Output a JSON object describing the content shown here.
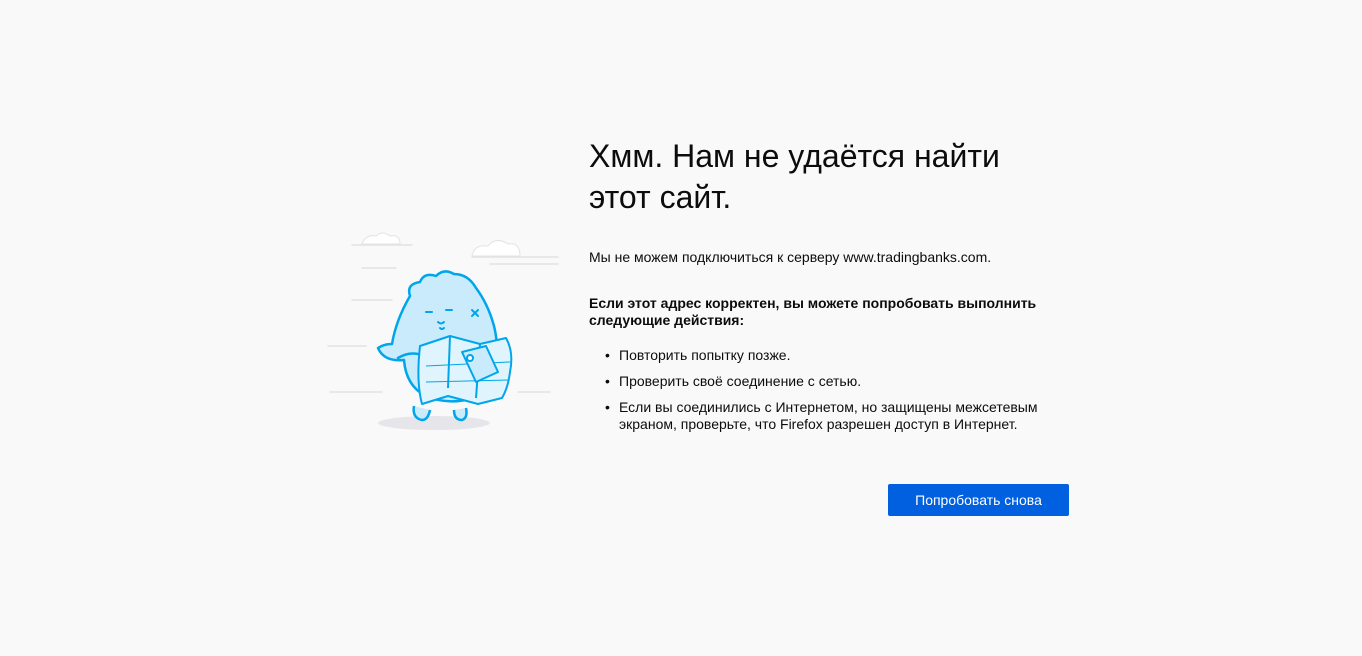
{
  "error": {
    "title": "Хмм. Нам не удаётся найти этот сайт.",
    "description": "Мы не можем подключиться к серверу www.tradingbanks.com.",
    "advice_heading": "Если этот адрес корректен, вы можете попробовать выполнить следующие действия:",
    "steps": [
      "Повторить попытку позже.",
      "Проверить своё соединение с сетью.",
      "Если вы соединились с Интернетом, но защищены межсетевым экраном, проверьте, что Firefox разрешен доступ в Интернет."
    ],
    "bullet": "•",
    "retry_label": "Попробовать снова"
  },
  "illustration": {
    "icon": "lost-map-dino-icon",
    "accent": "#00a6eb",
    "fill": "#c9ebfb",
    "cloud": "#ededf0"
  },
  "colors": {
    "background": "#f9f9fa",
    "primary_button": "#0060df",
    "text": "#0c0c0d"
  }
}
